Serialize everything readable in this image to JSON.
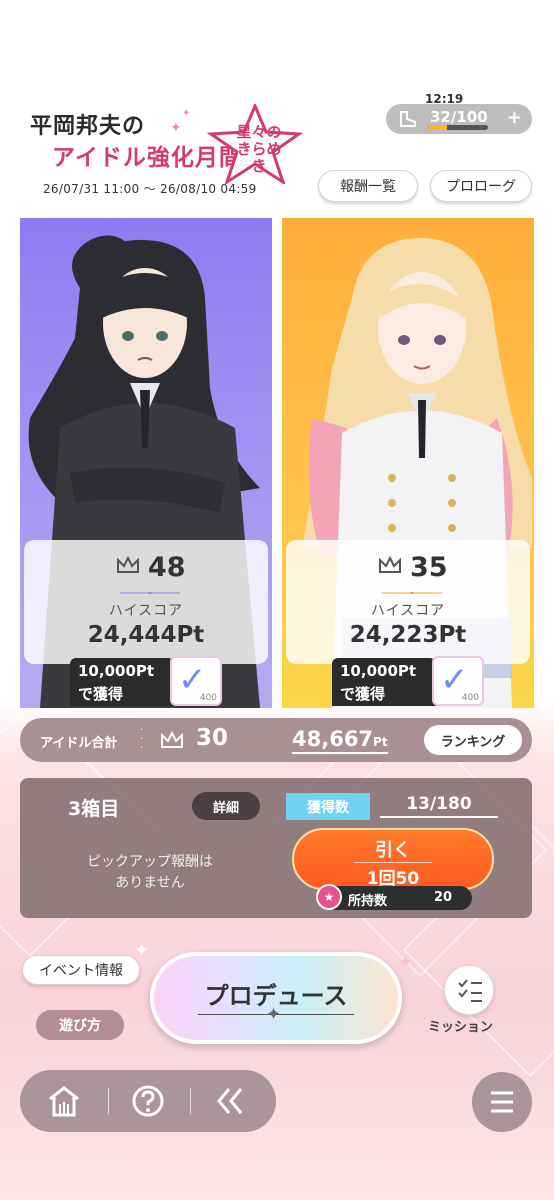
{
  "status": {
    "time": "12:19",
    "stamina": "32/100",
    "stamina_fraction": 0.32
  },
  "event": {
    "title_line1": "平岡邦夫の",
    "title_line2": "アイドル強化月間",
    "subtitle": "星々のきらめき",
    "period": "26/07/31 11:00 ～ 26/08/10 04:59"
  },
  "header_buttons": {
    "rewards_list": "報酬一覧",
    "prologue": "プロローグ"
  },
  "idols": [
    {
      "rank": "48",
      "label": "ハイスコア",
      "score": "24,444Pt",
      "reward_line1": "10,000Pt",
      "reward_line2": "で獲得",
      "reward_count": "400",
      "accent": "#8f82f0"
    },
    {
      "rank": "35",
      "label": "ハイスコア",
      "score": "24,223Pt",
      "reward_line1": "10,000Pt",
      "reward_line2": "で獲得",
      "reward_count": "400",
      "accent": "#f2a338"
    }
  ],
  "total": {
    "label": "アイドル合計",
    "rank": "30",
    "points": "48,667",
    "unit": "Pt",
    "ranking_button": "ランキング"
  },
  "box": {
    "name": "3箱目",
    "detail_button": "詳細",
    "acquired_label": "獲得数",
    "acquired_count": "13/180",
    "pickup_line1": "ピックアップ報酬は",
    "pickup_line2": "ありません",
    "draw_label": "引く",
    "draw_cost": "1回50",
    "owned_label": "所持数",
    "owned_count": "20"
  },
  "bottom": {
    "event_info": "イベント情報",
    "how_to_play": "遊び方",
    "produce": "プロデュース",
    "mission": "ミッション"
  },
  "colors": {
    "draw_button": "#ff6a25",
    "acquired_tab": "#6fd3f2",
    "panel": "#826e72"
  }
}
